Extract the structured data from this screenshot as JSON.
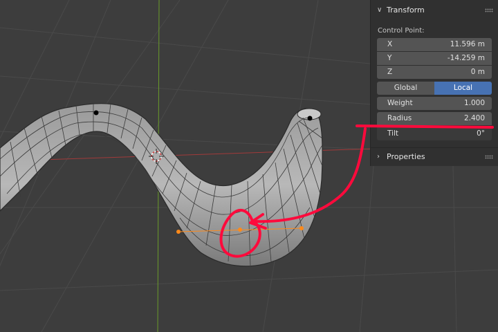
{
  "panel": {
    "transform_title": "Transform",
    "section_label": "Control Point:",
    "fields": {
      "x": {
        "label": "X",
        "value": "11.596 m"
      },
      "y": {
        "label": "Y",
        "value": "-14.259 m"
      },
      "z": {
        "label": "Z",
        "value": "0 m"
      },
      "weight": {
        "label": "Weight",
        "value": "1.000"
      },
      "radius": {
        "label": "Radius",
        "value": "2.400"
      },
      "tilt": {
        "label": "Tilt",
        "value": "0°"
      }
    },
    "space_toggle": {
      "global": "Global",
      "local": "Local",
      "selected": "Local"
    },
    "properties_title": "Properties"
  },
  "colors": {
    "viewport_bg": "#3d3d3d",
    "panel_bg": "#303030",
    "field_bg": "#545454",
    "accent_blue": "#4772b3",
    "annotation_red": "#ff0a3c",
    "handle_orange": "#ff8a1a",
    "x_axis_red": "#a23a3a",
    "y_axis_green": "#6a9b2a"
  },
  "icons": {
    "transform_chevron": "chevron-down-icon",
    "properties_chevron": "chevron-right-icon",
    "drag_grip": "grip-dots-icon",
    "cursor_3d": "3d-cursor-icon"
  }
}
